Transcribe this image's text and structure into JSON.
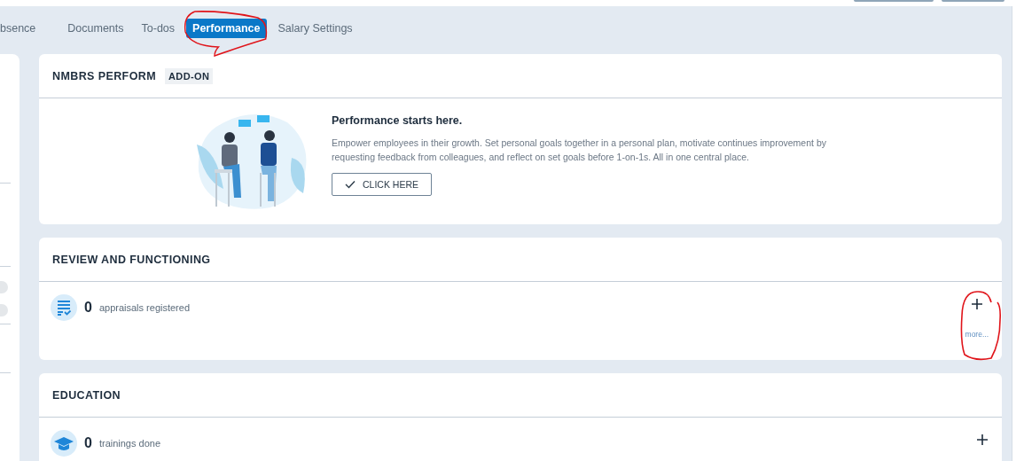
{
  "tabs": [
    {
      "label": "bsence",
      "selected": false
    },
    {
      "label": "Documents",
      "selected": false
    },
    {
      "label": "To-dos",
      "selected": false
    },
    {
      "label": "Performance",
      "selected": true
    },
    {
      "label": "Salary Settings",
      "selected": false
    }
  ],
  "cards": [
    {
      "kind": "promo",
      "title": "NMBRS PERFORM",
      "badge": "ADD-ON",
      "heading": "Performance starts here.",
      "text": "Empower employees in their growth. Set personal goals together in a personal plan, motivate continues improvement by requesting feedback from colleagues, and reflect on set goals before 1-on-1s. All in one central place.",
      "button": "CLICK HERE"
    },
    {
      "kind": "stat",
      "title": "REVIEW AND FUNCTIONING",
      "count": "0",
      "label": "appraisals registered",
      "more": "more..."
    },
    {
      "kind": "stat",
      "title": "EDUCATION",
      "count": "0",
      "label": "trainings done"
    }
  ]
}
